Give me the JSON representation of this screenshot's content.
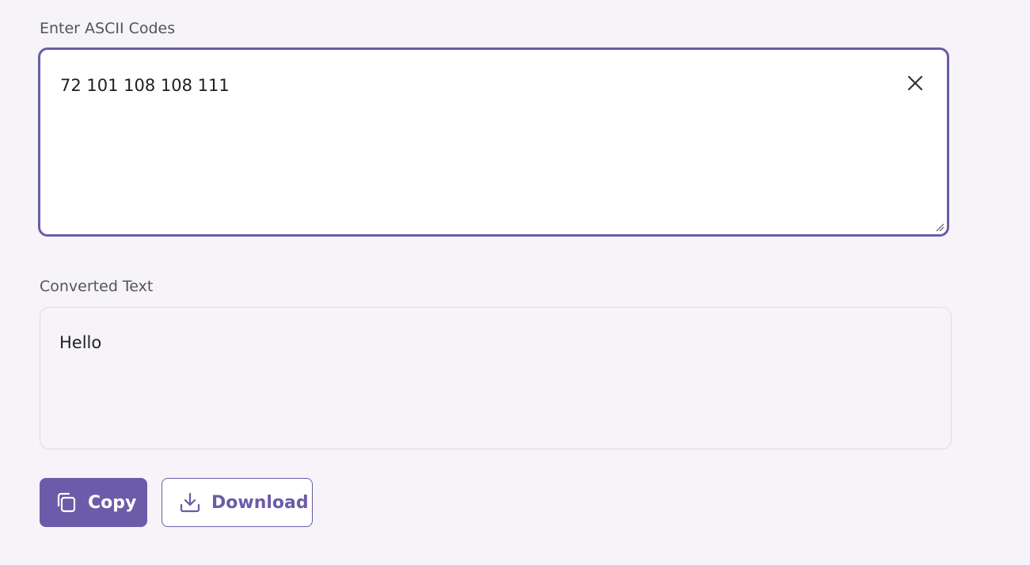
{
  "input": {
    "label": "Enter ASCII Codes",
    "value": "72 101 108 108 111",
    "clear_icon": "close-icon"
  },
  "output": {
    "label": "Converted Text",
    "value": "Hello"
  },
  "actions": {
    "copy_label": "Copy",
    "copy_icon": "copy-icon",
    "download_label": "Download",
    "download_icon": "download-icon"
  },
  "colors": {
    "accent": "#6c5ba8",
    "background": "#f6f4f8"
  }
}
